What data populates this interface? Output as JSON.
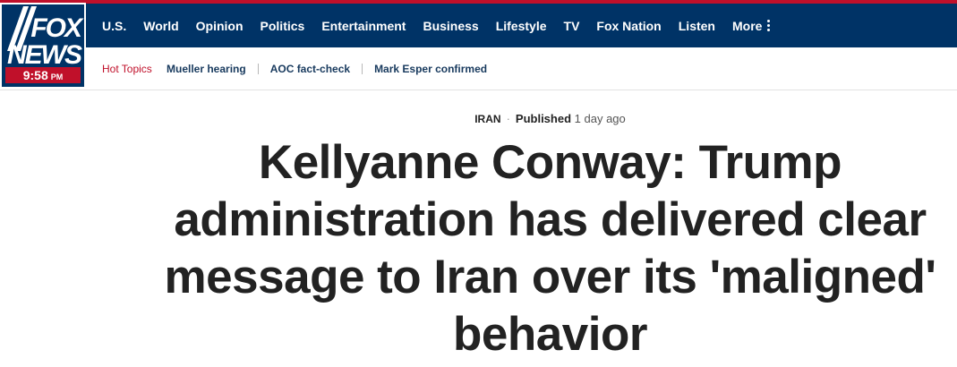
{
  "brand": {
    "logo_line1": "FOX",
    "logo_line2": "NEWS",
    "time": "9:58",
    "ampm": "PM",
    "colors": {
      "navy": "#003366",
      "red": "#c0102a"
    }
  },
  "nav": {
    "items": [
      "U.S.",
      "World",
      "Opinion",
      "Politics",
      "Entertainment",
      "Business",
      "Lifestyle",
      "TV",
      "Fox Nation",
      "Listen"
    ],
    "more_label": "More",
    "more_icon": "kebab-menu-icon"
  },
  "hot_topics": {
    "label": "Hot Topics",
    "links": [
      "Mueller hearing",
      "AOC fact-check",
      "Mark Esper confirmed"
    ]
  },
  "article": {
    "category": "IRAN",
    "published_label": "Published",
    "published_ago": "1 day ago",
    "headline": "Kellyanne Conway: Trump administration has delivered clear message to Iran over its 'maligned' behavior"
  }
}
